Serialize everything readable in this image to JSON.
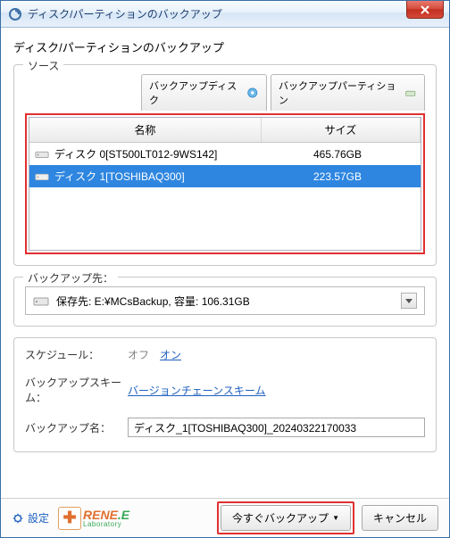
{
  "window": {
    "title": "ディスク/パーティションのバックアップ"
  },
  "subtitle": "ディスク/パーティションのバックアップ",
  "source": {
    "legend": "ソース",
    "tabs": [
      {
        "label": "バックアップディスク",
        "icon": "disk"
      },
      {
        "label": "バックアップパーティション",
        "icon": "partition"
      }
    ],
    "headers": {
      "name": "名称",
      "size": "サイズ"
    },
    "rows": [
      {
        "name": "ディスク 0[ST500LT012-9WS142]",
        "size": "465.76GB",
        "selected": false
      },
      {
        "name": "ディスク 1[TOSHIBAQ300]",
        "size": "223.57GB",
        "selected": true
      }
    ]
  },
  "destination": {
    "legend": "バックアップ先：",
    "label": "保存先: E:¥MCsBackup, 容量: 106.31GB"
  },
  "options": {
    "schedule_label": "スケジュール：",
    "schedule_off": "オフ",
    "schedule_on": "オン",
    "scheme_label": "バックアップスキーム：",
    "scheme_link": "バージョンチェーンスキーム",
    "name_label": "バックアップ名：",
    "name_value": "ディスク_1[TOSHIBAQ300]_20240322170033"
  },
  "footer": {
    "settings": "設定",
    "logo_main1": "RENE",
    "logo_main2": ".E",
    "logo_sub": "Laboratory",
    "backup_now": "今すぐバックアップ",
    "cancel": "キャンセル"
  }
}
